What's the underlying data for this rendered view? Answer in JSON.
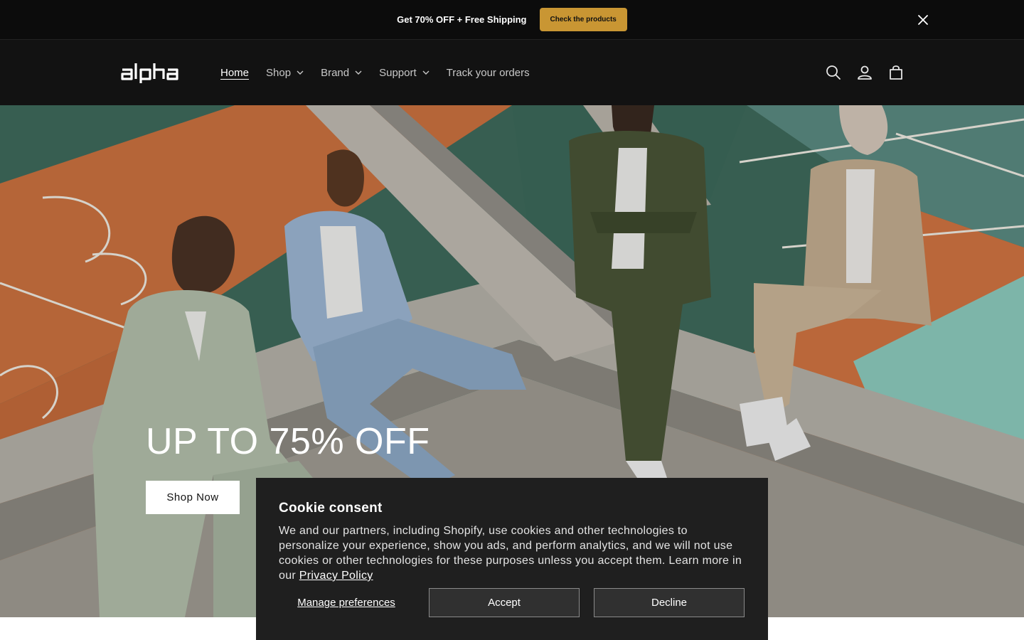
{
  "announcement": {
    "text": "Get 70% OFF + Free Shipping",
    "cta_label": "Check the products"
  },
  "header": {
    "logo_text": "alpha",
    "nav": [
      {
        "label": "Home"
      },
      {
        "label": "Shop"
      },
      {
        "label": "Brand"
      },
      {
        "label": "Support"
      },
      {
        "label": "Track your orders"
      }
    ]
  },
  "hero": {
    "headline": "UP TO 75% OFF",
    "cta_label": "Shop Now"
  },
  "cookie": {
    "title": "Cookie consent",
    "body": "We and our partners, including Shopify, use cookies and other technologies to personalize your experience, show you ads, and perform analytics, and we will not use cookies or other technologies for these purposes unless you accept them. Learn more in our ",
    "privacy_link": "Privacy Policy",
    "manage_label": "Manage preferences",
    "accept_label": "Accept",
    "decline_label": "Decline"
  },
  "colors": {
    "announcement_bg": "#0c0c0c",
    "cta_gold": "#c99633",
    "header_bg": "#121212",
    "cookie_bg": "#1f1f1f"
  },
  "icons": [
    "close-icon",
    "search-icon",
    "account-icon",
    "cart-icon",
    "chevron-down-icon"
  ]
}
